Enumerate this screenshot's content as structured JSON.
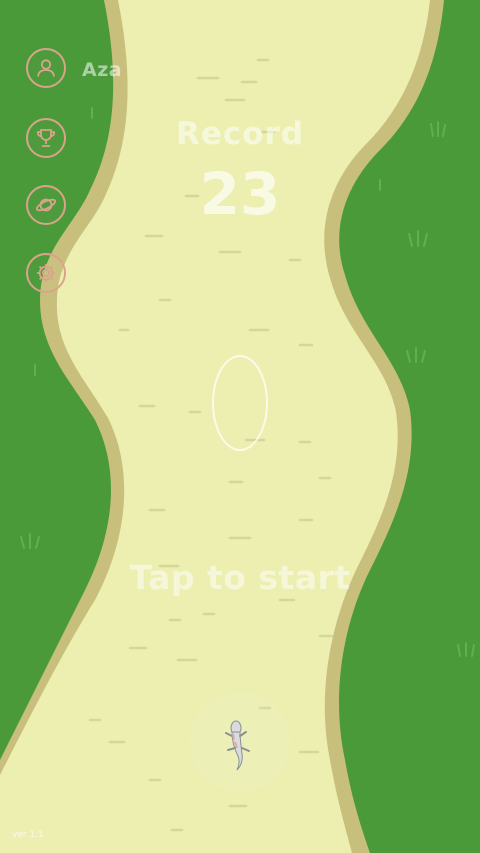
{
  "player": {
    "username": "Aza"
  },
  "menu": {
    "profile_icon": "user-icon",
    "trophy_icon": "trophy-icon",
    "planet_icon": "planet-icon",
    "settings_icon": "gear-icon"
  },
  "score": {
    "label": "Record",
    "value": "23"
  },
  "prompt": {
    "tap_to_start": "Tap to start"
  },
  "footer": {
    "version": "ver 1.1"
  },
  "colors": {
    "grass": "#4a9a3a",
    "path": "#ecefb0",
    "path_edge": "#c9bf7d",
    "button_ring": "#d9a48a"
  }
}
